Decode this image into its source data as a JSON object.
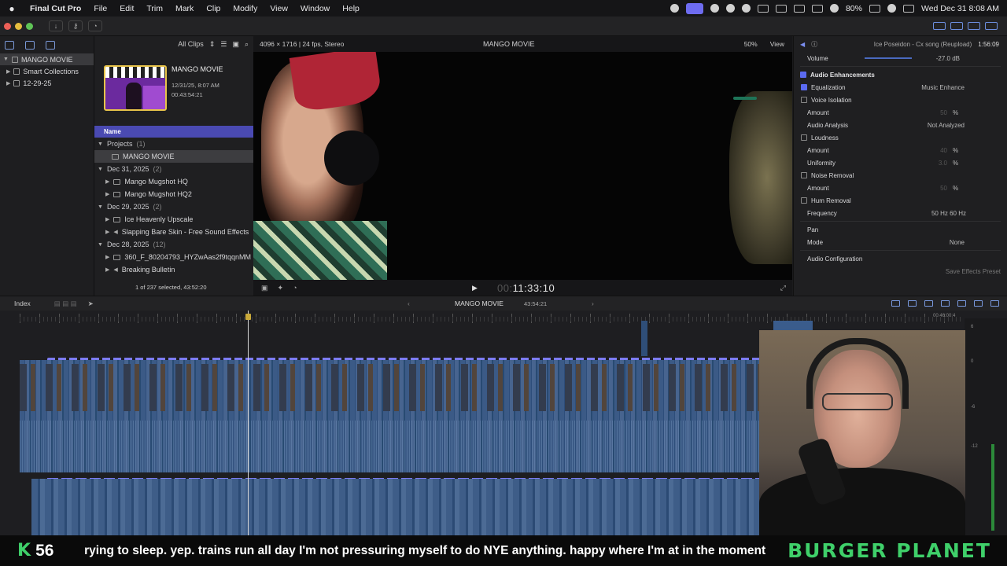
{
  "menubar": {
    "app": "Final Cut Pro",
    "items": [
      "File",
      "Edit",
      "Trim",
      "Mark",
      "Clip",
      "Modify",
      "View",
      "Window",
      "Help"
    ],
    "battery": "80%",
    "datetime": "Wed Dec 31  8:08 AM"
  },
  "browser": {
    "filter": "All Clips",
    "thumb_title": "MANGO MOVIE",
    "thumb_date": "12/31/25, 8:07 AM",
    "thumb_duration": "00:43:54:21",
    "column_name": "Name",
    "groups": [
      {
        "label": "Projects",
        "count": "(1)",
        "items": [
          "MANGO MOVIE"
        ]
      },
      {
        "label": "Dec 31, 2025",
        "count": "(2)",
        "items": [
          "Mango Mugshot HQ",
          "Mango Mugshot HQ2"
        ]
      },
      {
        "label": "Dec 29, 2025",
        "count": "(2)",
        "items": [
          "Ice Heavenly Upscale",
          "Slapping Bare Skin - Free Sound Effects"
        ]
      },
      {
        "label": "Dec 28, 2025",
        "count": "(12)",
        "items": [
          "360_F_80204793_HYZwAas2f9tqqnMM",
          "Breaking Bulletin"
        ]
      }
    ],
    "footer": "1 of 237 selected, 43:52:20"
  },
  "library": {
    "items": [
      {
        "label": "MANGO MOVIE"
      },
      {
        "label": "Smart Collections"
      },
      {
        "label": "12-29-25"
      }
    ]
  },
  "viewer": {
    "format": "4096 × 1716 | 24 fps, Stereo",
    "name": "MANGO MOVIE",
    "zoom": "50%",
    "view": "View",
    "timecode": "11:33:10",
    "timecode_prefix": "00:"
  },
  "inspector": {
    "clip_name": "Ice Poseidon - Cx song (Reupload)",
    "duration": "1:56:09",
    "volume_label": "Volume",
    "volume_value": "-27.0  dB",
    "section": "Audio Enhancements",
    "rows": [
      {
        "label": "Equalization",
        "value": "Music Enhance",
        "check": true
      },
      {
        "label": "Voice Isolation",
        "value": "",
        "check": false
      },
      {
        "label": "Amount",
        "value": "50",
        "pct": "%"
      },
      {
        "label": "Audio Analysis",
        "value": "Not Analyzed"
      },
      {
        "label": "Loudness",
        "value": "",
        "check": false
      },
      {
        "label": "Amount",
        "value": "40",
        "pct": "%"
      },
      {
        "label": "Uniformity",
        "value": "3.0",
        "pct": "%"
      },
      {
        "label": "Noise Removal",
        "value": "",
        "check": false
      },
      {
        "label": "Amount",
        "value": "50",
        "pct": "%"
      },
      {
        "label": "Hum Removal",
        "value": "",
        "check": false
      },
      {
        "label": "Frequency",
        "value": "50 Hz      60 Hz"
      }
    ],
    "pan": "Pan",
    "mode_label": "Mode",
    "mode_value": "None",
    "config": "Audio Configuration",
    "save_preset": "Save Effects Preset"
  },
  "timeline": {
    "index": "Index",
    "project": "MANGO MOVIE",
    "duration": "43:54:21",
    "ruler_end": "00:46:00:4",
    "meter_labels": [
      "6",
      "0",
      "-6",
      "-12"
    ]
  },
  "ticker": {
    "k": "K",
    "count": "56",
    "message": "rying to sleep. yep. trains run all day I'm not pressuring myself to do NYE anything. happy where I'm at in the moment",
    "brand": "BURGER PLANET"
  },
  "colors": {
    "accent": "#4a4ab2",
    "track": "#3b5a86",
    "marker": "#7c7cf2",
    "ticker_green": "#3fd06a"
  }
}
